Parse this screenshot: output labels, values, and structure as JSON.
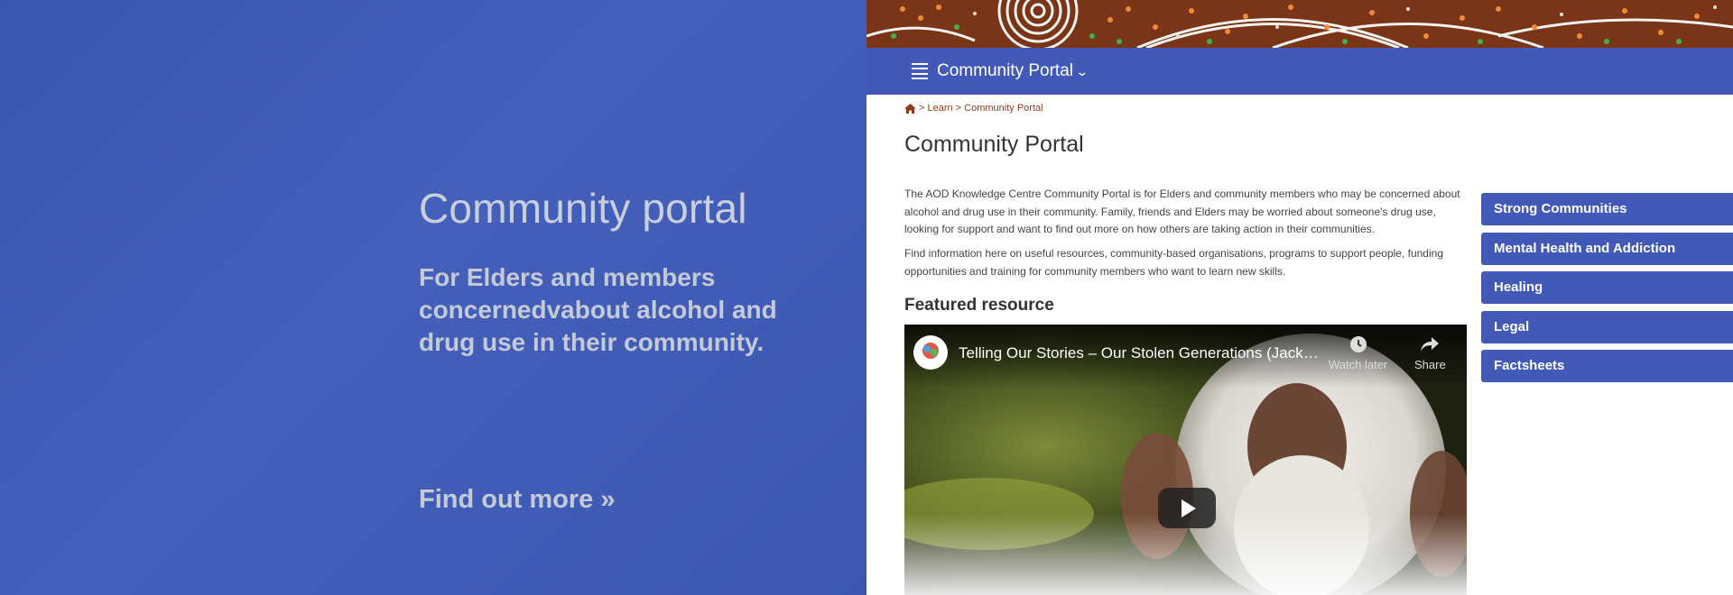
{
  "hero": {
    "title": "Community portal",
    "subtitle": "For Elders and members concernedvabout alcohol and drug use in their community.",
    "cta": "Find out more »"
  },
  "portal": {
    "nav_title": "Community Portal",
    "breadcrumb": [
      "> Learn > Community Portal"
    ],
    "page_title": "Community Portal",
    "intro": "The AOD Knowledge Centre Community Portal is for Elders and community members who may be concerned about alcohol and drug use in their community. Family, friends and Elders may be worried about someone's drug use, looking for support and want to find out more on how others are taking action in their communities.",
    "intro2": "Find information here on useful resources, community-based organisations, programs to support people, funding opportunities and training for community members who want to learn new skills.",
    "featured_heading": "Featured resource",
    "video": {
      "title": "Telling Our Stories – Our Stolen Generations (Jack ...",
      "watch_later": "Watch later",
      "share": "Share"
    },
    "side_nav": [
      "Strong Communities",
      "Mental Health and Addiction",
      "Healing",
      "Legal",
      "Factsheets"
    ]
  },
  "colors": {
    "hero_bg": "#3f5bb3",
    "nav_blue": "#4259b7",
    "breadcrumb_brown": "#8a3c1e"
  }
}
